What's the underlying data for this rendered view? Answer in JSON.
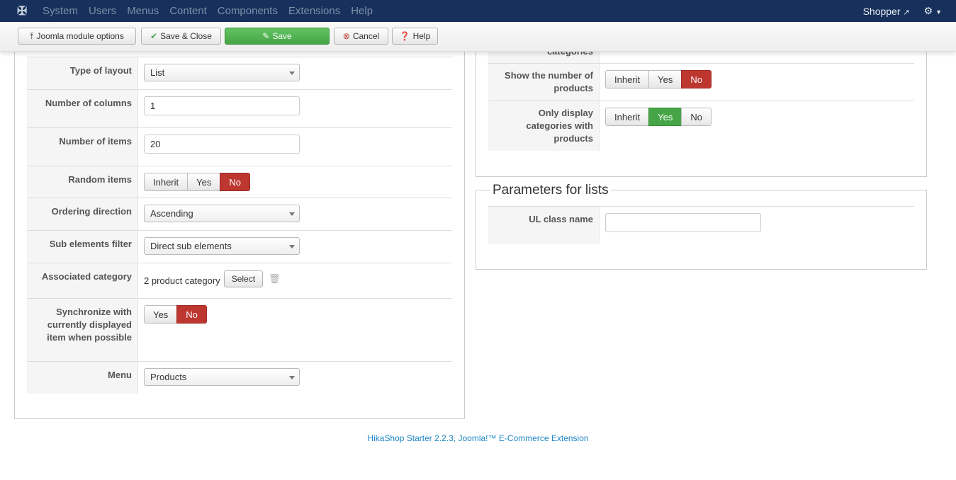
{
  "nav": {
    "menu": [
      "System",
      "Users",
      "Menus",
      "Content",
      "Components",
      "Extensions",
      "Help"
    ],
    "user": "Shopper"
  },
  "toolbar": {
    "module_options": "Joomla module options",
    "save_close": "Save & Close",
    "save": "Save",
    "cancel": "Cancel",
    "help": "Help"
  },
  "left": {
    "type_of_layout": {
      "label": "Type of layout",
      "value": "List"
    },
    "columns": {
      "label": "Number of columns",
      "value": "1"
    },
    "items": {
      "label": "Number of items",
      "value": "20"
    },
    "random": {
      "label": "Random items",
      "options": [
        "Inherit",
        "Yes",
        "No"
      ],
      "selected": "No"
    },
    "ordering": {
      "label": "Ordering direction",
      "value": "Ascending"
    },
    "sub": {
      "label": "Sub elements filter",
      "value": "Direct sub elements"
    },
    "assoc": {
      "label": "Associated category",
      "value": "2 product category",
      "button": "Select"
    },
    "sync": {
      "label": "Synchronize with currently displayed item when possible",
      "options": [
        "Yes",
        "No"
      ],
      "selected": "No"
    },
    "menu": {
      "label": "Menu",
      "value": "Products"
    }
  },
  "right": {
    "partial_label": "categories",
    "show_number": {
      "label": "Show the number of products",
      "options": [
        "Inherit",
        "Yes",
        "No"
      ],
      "selected": "No"
    },
    "only_display": {
      "label": "Only display categories with products",
      "options": [
        "Inherit",
        "Yes",
        "No"
      ],
      "selected": "Yes"
    },
    "lists_legend": "Parameters for lists",
    "ul_class": {
      "label": "UL class name",
      "value": ""
    }
  },
  "footer": "HikaShop Starter 2.2.3, Joomla!™ E-Commerce Extension"
}
